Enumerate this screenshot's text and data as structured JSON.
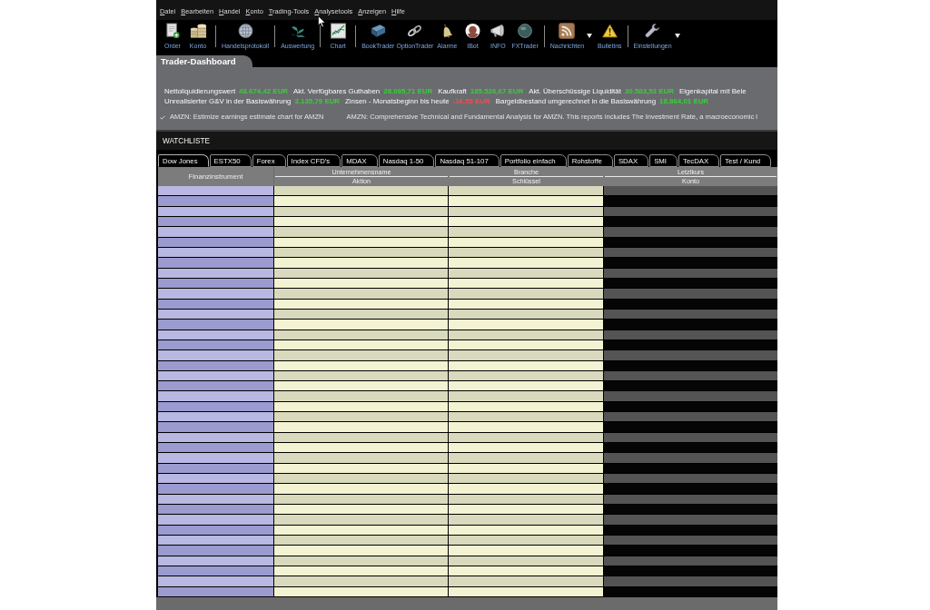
{
  "menu": [
    "Datei",
    "Bearbeiten",
    "Handel",
    "Konto",
    "Trading-Tools",
    "Analysetools",
    "Anzeigen",
    "Hilfe"
  ],
  "toolbar": [
    {
      "kind": "button",
      "label": "Order",
      "has_menu": false
    },
    {
      "kind": "button",
      "label": "Konto",
      "has_menu": false
    },
    {
      "kind": "separator"
    },
    {
      "kind": "button",
      "label": "Handelsprotokoll",
      "has_menu": false
    },
    {
      "kind": "separator"
    },
    {
      "kind": "button",
      "label": "Auswertung",
      "has_menu": false
    },
    {
      "kind": "separator"
    },
    {
      "kind": "button",
      "label": "Chart",
      "has_menu": false
    },
    {
      "kind": "separator"
    },
    {
      "kind": "button",
      "label": "BookTrader",
      "has_menu": false
    },
    {
      "kind": "button",
      "label": "OptionTrader",
      "has_menu": false
    },
    {
      "kind": "button",
      "label": "Alarme",
      "has_menu": false
    },
    {
      "kind": "button",
      "label": "IBot",
      "has_menu": false
    },
    {
      "kind": "button",
      "label": "INFO",
      "has_menu": false
    },
    {
      "kind": "button",
      "label": "FXTrader",
      "has_menu": false
    },
    {
      "kind": "separator"
    },
    {
      "kind": "button",
      "label": "Nachrichten",
      "has_menu": true
    },
    {
      "kind": "button",
      "label": "Bulletins",
      "has_menu": false
    },
    {
      "kind": "separator"
    },
    {
      "kind": "button",
      "label": "Einstellungen",
      "has_menu": true
    }
  ],
  "dashboard": {
    "title": "Trader-Dashboard",
    "summary_lines": [
      {
        "items": [
          {
            "label": "Nettoliquidierungswert",
            "value": "48.674,42 EUR",
            "color": "#2fd62f"
          },
          {
            "label": "Akt. Verfügbares Guthaben",
            "value": "28.095,71 EUR",
            "color": "#2fd62f"
          },
          {
            "label": "Kaufkraft",
            "value": "185.526,67 EUR",
            "color": "#2fd62f"
          },
          {
            "label": "Akt. Überschüssige Liquidität",
            "value": "30.583,53 EUR",
            "color": "#2fd62f"
          },
          {
            "label": "Eigenkapital mit Bele"
          }
        ]
      },
      {
        "items": [
          {
            "label": "Unrealisierter G&V in der Basiswährung",
            "value": "3.135,79 EUR",
            "color": "#2fd62f"
          },
          {
            "label": "Zinsen - Monatsbeginn bis heute",
            "value": "-16,55 EUR",
            "color": "#ff4848"
          },
          {
            "label": "Bargeldbestand umgerechnet in die Basiswährung",
            "value": "18.864,01 EUR",
            "color": "#2fd62f"
          }
        ]
      }
    ],
    "news": [
      {
        "text": "AMZN: Estimize earnings estimate chart for AMZN"
      },
      {
        "text": "AMZN: Comprehensive Technical and Fundamental Analysis for AMZN. This reports includes The Investment Rate, a macroeconomic l"
      }
    ]
  },
  "watchlist": {
    "title": "WATCHLISTE",
    "tabs": [
      {
        "label": "Dow Jones",
        "selected": true
      },
      {
        "label": "ESTX50",
        "selected": false
      },
      {
        "label": "Forex",
        "selected": false
      },
      {
        "label": "Index CFD's",
        "selected": false
      },
      {
        "label": "MDAX",
        "selected": false
      },
      {
        "label": "Nasdaq 1-50",
        "selected": false
      },
      {
        "label": "Nasdaq 51-107",
        "selected": false
      },
      {
        "label": "Portfolio einfach",
        "selected": false
      },
      {
        "label": "Rohstoffe",
        "selected": false
      },
      {
        "label": "SDAX",
        "selected": false
      },
      {
        "label": "SMI",
        "selected": false
      },
      {
        "label": "TecDAX",
        "selected": false
      },
      {
        "label": "Test / Kund",
        "selected": false
      }
    ],
    "columns": [
      {
        "label": "Finanzinstrument"
      },
      {
        "label": "Unternehmensname",
        "sublabel": "Aktion"
      },
      {
        "label": "Branche",
        "sublabel": "Schlüssel"
      },
      {
        "label": "Letztkurs",
        "sublabel": "Konto"
      }
    ]
  }
}
